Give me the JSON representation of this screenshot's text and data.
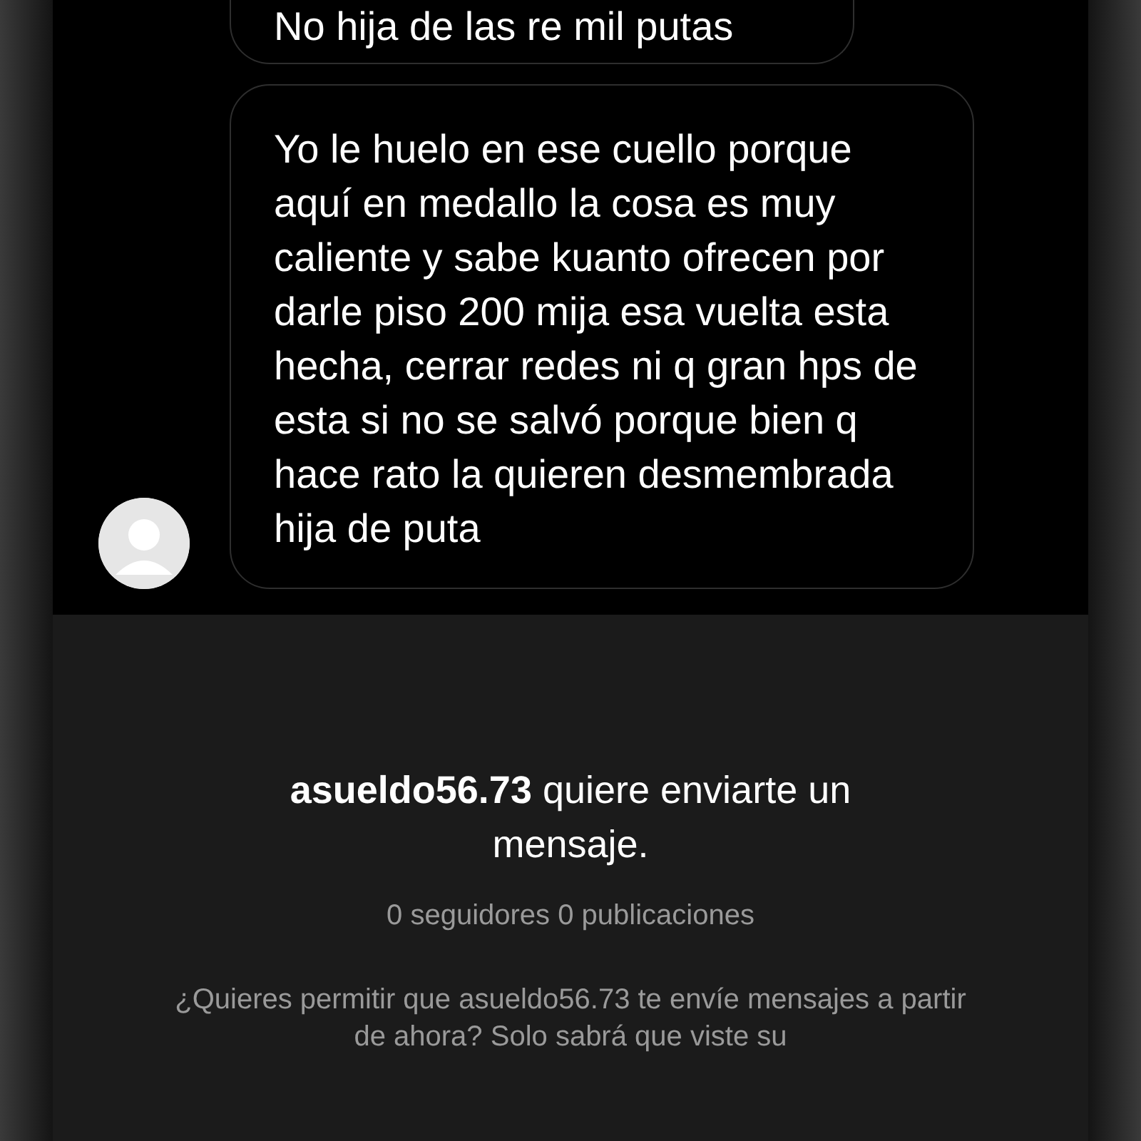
{
  "messages": [
    {
      "text": "No hija de las re mil putas",
      "show_avatar": false
    },
    {
      "text": "Yo le huelo en ese cuello porque aquí en medallo la cosa es muy caliente y sabe kuanto ofrecen por darle piso 200 mija esa vuelta esta hecha, cerrar redes ni q gran hps de esta si no se salvó porque bien q hace rato la quieren desmembrada hija de puta",
      "show_avatar": true
    }
  ],
  "request": {
    "title": "**asueldo56.73** quiere enviarte un mensaje.",
    "stats": "0 seguidores 0 publicaciones",
    "question": "¿Quieres permitir que asueldo56.73 te envíe mensajes a partir de ahora? Solo sabrá que viste su"
  }
}
